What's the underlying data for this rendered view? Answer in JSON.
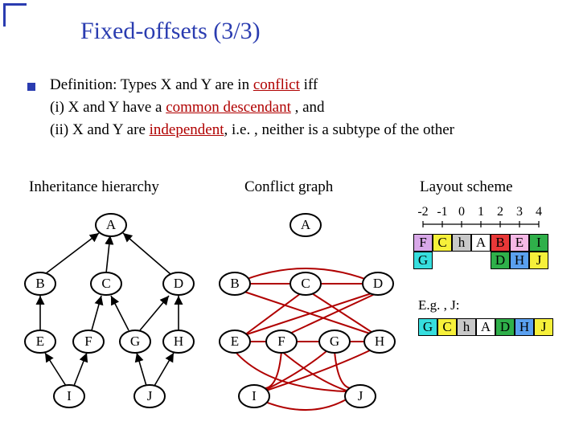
{
  "title": "Fixed-offsets (3/3)",
  "defn": {
    "line1_a": "Definition: Types X and Y are in ",
    "line1_red": "conflict",
    "line1_b": " iff",
    "line2_a": "(i)  X and Y have a ",
    "line2_red": "common descendant",
    "line2_b": " , and",
    "line3_a": "(ii) X and Y are ",
    "line3_red": "independent",
    "line3_b": ", i.e. , neither is a subtype of the other"
  },
  "sections": {
    "left": "Inheritance hierarchy",
    "mid": "Conflict graph",
    "right": "Layout scheme"
  },
  "nodes": [
    "A",
    "B",
    "C",
    "D",
    "E",
    "F",
    "G",
    "H",
    "I",
    "J"
  ],
  "axis": [
    "-2",
    "-1",
    "0",
    "1",
    "2",
    "3",
    "4"
  ],
  "row1": [
    {
      "t": "F",
      "c": "c-lav"
    },
    {
      "t": "C",
      "c": "c-ylw"
    },
    {
      "t": "h",
      "c": "c-gry"
    },
    {
      "t": "A",
      "c": "c-white"
    },
    {
      "t": "B",
      "c": "c-red"
    },
    {
      "t": "E",
      "c": "c-pnk"
    },
    {
      "t": "I",
      "c": "c-grn"
    }
  ],
  "row2": [
    {
      "t": "G",
      "c": "c-cyn"
    },
    {
      "t": "",
      "c": ""
    },
    {
      "t": "",
      "c": ""
    },
    {
      "t": "",
      "c": ""
    },
    {
      "t": "D",
      "c": "c-grn"
    },
    {
      "t": "H",
      "c": "c-blu"
    },
    {
      "t": "J",
      "c": "c-ylw"
    }
  ],
  "eg_label": "E.g. , J:",
  "eg_cells": [
    {
      "t": "G",
      "c": "c-cyn"
    },
    {
      "t": "C",
      "c": "c-ylw"
    },
    {
      "t": "h",
      "c": "c-gry"
    },
    {
      "t": "A",
      "c": "c-white"
    },
    {
      "t": "D",
      "c": "c-grn"
    },
    {
      "t": "H",
      "c": "c-blu"
    },
    {
      "t": "J",
      "c": "c-ylw"
    }
  ]
}
